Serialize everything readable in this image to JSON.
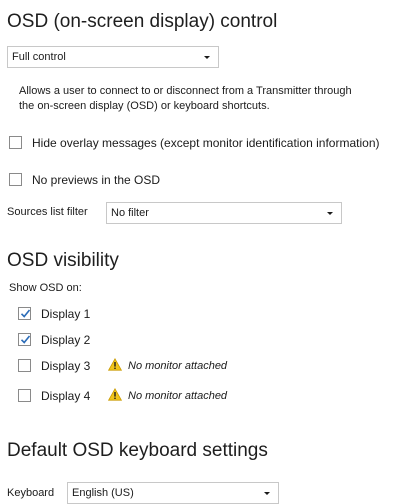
{
  "osd_control": {
    "title": "OSD (on-screen display) control",
    "mode_value": "Full control",
    "description_line1": "Allows a user to connect to or disconnect from a Transmitter through",
    "description_line2": "the on-screen display (OSD) or keyboard shortcuts.",
    "hide_overlay": {
      "label": "Hide overlay messages (except monitor identification information)",
      "checked": false
    },
    "no_previews": {
      "label": "No previews in the OSD",
      "checked": false
    },
    "sources_filter": {
      "label": "Sources list filter",
      "value": "No filter"
    }
  },
  "osd_visibility": {
    "title": "OSD visibility",
    "show_on_label": "Show OSD on:",
    "displays": [
      {
        "label": "Display 1",
        "checked": true,
        "warning": ""
      },
      {
        "label": "Display 2",
        "checked": true,
        "warning": ""
      },
      {
        "label": "Display 3",
        "checked": false,
        "warning": "No monitor attached"
      },
      {
        "label": "Display 4",
        "checked": false,
        "warning": "No monitor attached"
      }
    ]
  },
  "keyboard_settings": {
    "title": "Default OSD keyboard settings",
    "keyboard_label": "Keyboard",
    "keyboard_value": "English (US)"
  },
  "icons": {
    "check": "checkmark-icon",
    "warning": "warning-icon",
    "dropdown": "chevron-down-icon"
  },
  "colors": {
    "checkmark": "#2b6cb8",
    "warning_fill": "#f0c419",
    "warning_mark": "#1b1b1b"
  }
}
